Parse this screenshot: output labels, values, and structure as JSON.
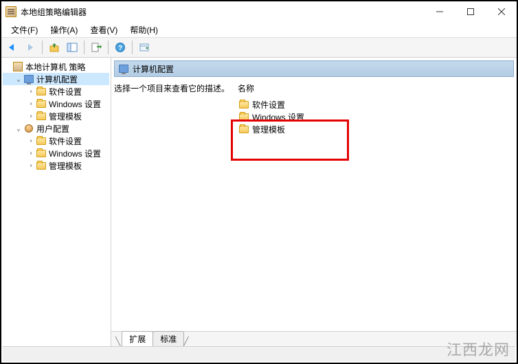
{
  "window": {
    "title": "本地组策略编辑器"
  },
  "menu": {
    "file": "文件(F)",
    "action": "操作(A)",
    "view": "查看(V)",
    "help": "帮助(H)"
  },
  "tree": {
    "root": "本地计算机 策略",
    "computer_config": "计算机配置",
    "software_settings": "软件设置",
    "windows_settings": "Windows 设置",
    "admin_templates": "管理模板",
    "user_config": "用户配置"
  },
  "detail": {
    "header": "计算机配置",
    "description": "选择一个项目来查看它的描述。",
    "column_name": "名称",
    "items": {
      "software": "软件设置",
      "windows": "Windows 设置",
      "admin": "管理模板"
    }
  },
  "tabs": {
    "extended": "扩展",
    "standard": "标准"
  },
  "watermark": "江西龙网"
}
